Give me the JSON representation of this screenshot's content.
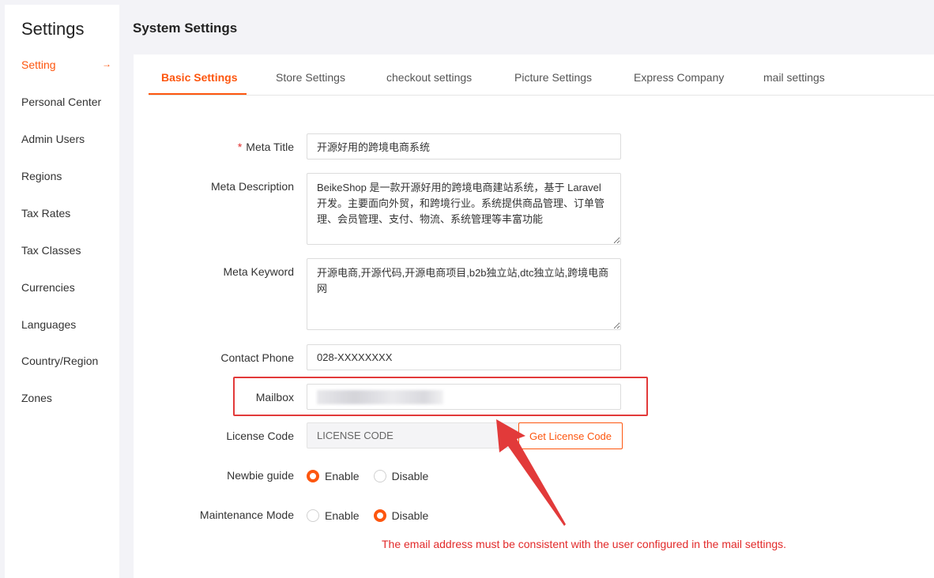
{
  "sidebar": {
    "title": "Settings",
    "items": [
      {
        "label": "Setting",
        "active": true,
        "arrow": "→"
      },
      {
        "label": "Personal Center"
      },
      {
        "label": "Admin Users"
      },
      {
        "label": "Regions"
      },
      {
        "label": "Tax Rates"
      },
      {
        "label": "Tax Classes"
      },
      {
        "label": "Currencies"
      },
      {
        "label": "Languages"
      },
      {
        "label": "Country/Region"
      },
      {
        "label": "Zones"
      }
    ]
  },
  "header": {
    "title": "System Settings"
  },
  "tabs": [
    {
      "label": "Basic Settings",
      "active": true
    },
    {
      "label": "Store Settings"
    },
    {
      "label": "checkout settings"
    },
    {
      "label": "Picture Settings"
    },
    {
      "label": "Express Company"
    },
    {
      "label": "mail settings"
    }
  ],
  "form": {
    "meta_title": {
      "label": "Meta Title",
      "required_mark": "*",
      "value": "开源好用的跨境电商系统"
    },
    "meta_description": {
      "label": "Meta Description",
      "value": "BeikeShop 是一款开源好用的跨境电商建站系统，基于 Laravel 开发。主要面向外贸，和跨境行业。系统提供商品管理、订单管理、会员管理、支付、物流、系统管理等丰富功能"
    },
    "meta_keyword": {
      "label": "Meta Keyword",
      "value": "开源电商,开源代码,开源电商项目,b2b独立站,dtc独立站,跨境电商网"
    },
    "contact_phone": {
      "label": "Contact Phone",
      "value": "028-XXXXXXXX"
    },
    "mailbox": {
      "label": "Mailbox",
      "value": ""
    },
    "license_code": {
      "label": "License Code",
      "value": "LICENSE CODE",
      "button": "Get License Code"
    },
    "newbie_guide": {
      "label": "Newbie guide",
      "options": [
        "Enable",
        "Disable"
      ],
      "selected": "Enable"
    },
    "maintenance_mode": {
      "label": "Maintenance Mode",
      "options": [
        "Enable",
        "Disable"
      ],
      "selected": "Disable"
    }
  },
  "annotation": {
    "text": "The email address must be consistent with the user configured in the mail settings.",
    "color": "#e22a2a"
  },
  "colors": {
    "accent": "#fd560f"
  }
}
